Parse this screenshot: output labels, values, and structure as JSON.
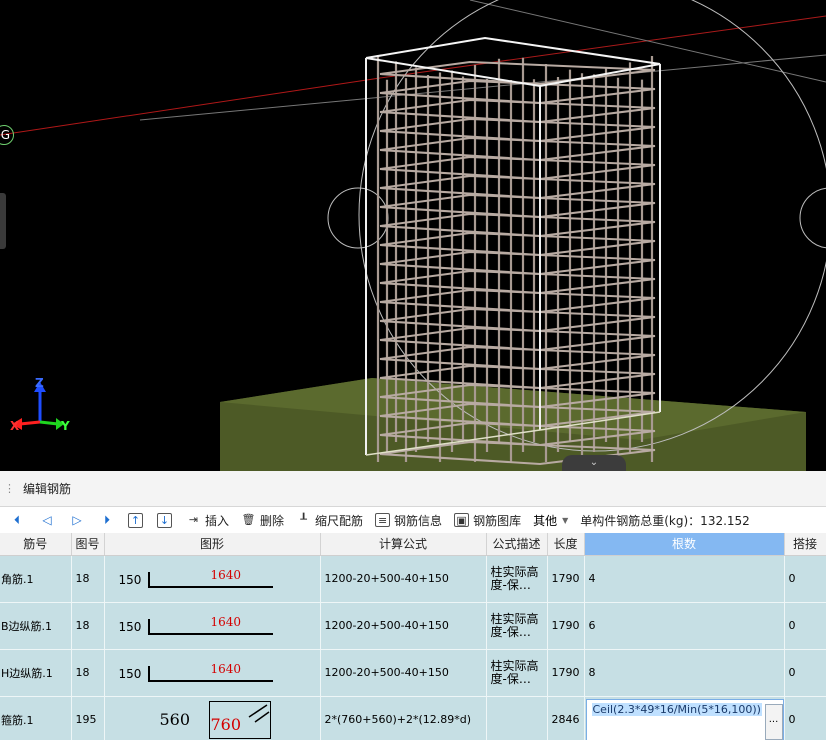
{
  "viewport": {
    "marker_label": "G",
    "axis_labels": {
      "x": "X",
      "y": "Y",
      "z": "Z"
    },
    "collapse_icon": "chevron-down-icon"
  },
  "panel": {
    "title": "编辑钢筋"
  },
  "toolbar": {
    "nav": [
      "⏴",
      "◁",
      "▷",
      "⏵"
    ],
    "move_up_icon": "arrow-up-icon",
    "move_down_icon": "arrow-down-icon",
    "insert_label": "插入",
    "delete_label": "删除",
    "scale_label": "缩尺配筋",
    "info_label": "钢筋信息",
    "library_label": "钢筋图库",
    "other_label": "其他",
    "weight_label": "单构件钢筋总重(kg)：132.152"
  },
  "table": {
    "headers": [
      "筋号",
      "图号",
      "图形",
      "计算公式",
      "公式描述",
      "长度",
      "根数",
      "搭接"
    ],
    "rows": [
      {
        "name": "角筋.1",
        "fig": "18",
        "shape_left": "150",
        "shape_value": "1640",
        "formula": "1200-20+500-40+150",
        "desc": "柱实际高度-保…",
        "length": "1790",
        "count": "4",
        "lap": "0"
      },
      {
        "name": "B边纵筋.1",
        "fig": "18",
        "shape_left": "150",
        "shape_value": "1640",
        "formula": "1200-20+500-40+150",
        "desc": "柱实际高度-保…",
        "length": "1790",
        "count": "6",
        "lap": "0"
      },
      {
        "name": "H边纵筋.1",
        "fig": "18",
        "shape_left": "150",
        "shape_value": "1640",
        "formula": "1200-20+500-40+150",
        "desc": "柱实际高度-保…",
        "length": "1790",
        "count": "8",
        "lap": "0"
      },
      {
        "name": "箍筋.1",
        "fig": "195",
        "shape_left": "560",
        "shape_value": "760",
        "formula": "2*(760+560)+2*(12.89*d)",
        "desc": "",
        "length": "2846",
        "count": "Ceil(2.3*49*16/Min(5*16,100))",
        "lap": "0",
        "ellipsis": "..."
      }
    ]
  }
}
